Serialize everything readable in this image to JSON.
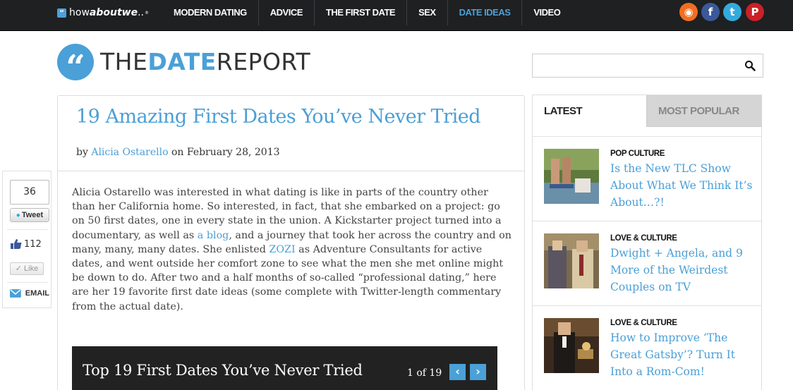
{
  "topbar": {
    "logo": {
      "how": "how",
      "about": "about",
      "we": "we",
      "dots": "..",
      "tm": "®"
    },
    "nav": [
      "MODERN DATING",
      "ADVICE",
      "THE FIRST DATE",
      "SEX",
      "DATE IDEAS",
      "VIDEO"
    ],
    "active_nav": "DATE IDEAS",
    "social": [
      {
        "name": "rss-icon",
        "glyph": "◉",
        "color": "#f26d21"
      },
      {
        "name": "facebook-icon",
        "glyph": "f",
        "color": "#3b5998"
      },
      {
        "name": "twitter-icon",
        "glyph": "t",
        "color": "#33aadd"
      },
      {
        "name": "pinterest-icon",
        "glyph": "P",
        "color": "#cb2027"
      }
    ]
  },
  "header": {
    "brand_left": "THE",
    "brand_mid": "DATE",
    "brand_right": "REPORT",
    "search_placeholder": ""
  },
  "article": {
    "title": "19 Amazing First Dates You’ve Never Tried",
    "by": "by",
    "author": "Alicia Ostarello",
    "on": "on February 28, 2013",
    "p1": "Alicia Ostarello was interested in what dating is like in parts of the country other than her California home. So interested, in fact, that she embarked on a project: go on 50 first dates, one in every state in the union. A Kickstarter project turned into a documentary, as well as ",
    "link1": "a blog",
    "p2": ", and a journey that took her across the country and on many, many, many dates. She enlisted ",
    "link2": "ZOZI",
    "p3": " as Adventure Consultants for active dates, and went outside her comfort zone to see what the men she met online might be down to do. After two and a half months of so-called “professional dating,” here are her 19 favorite first date ideas (some complete with Twitter-length commentary from the actual date)."
  },
  "slideshow": {
    "title": "Top 19 First Dates You’ve Never Tried",
    "counter": "1 of 19",
    "prev": "‹",
    "next": "›"
  },
  "share": {
    "tweet_count": "36",
    "tweet_label": "Tweet",
    "fb_count": "112",
    "like_label": "Like",
    "email_label": "EMAIL"
  },
  "sidebar": {
    "tabs": [
      "LATEST",
      "MOST POPULAR"
    ],
    "stories": [
      {
        "category": "POP CULTURE",
        "headline": "Is the New TLC Show About What We Think It’s About…?!"
      },
      {
        "category": "LOVE & CULTURE",
        "headline": "Dwight + Angela, and 9 More of the Weirdest Couples on TV"
      },
      {
        "category": "LOVE & CULTURE",
        "headline": "How to Improve ‘The Great Gatsby’? Turn It Into a Rom-Com!"
      }
    ]
  }
}
